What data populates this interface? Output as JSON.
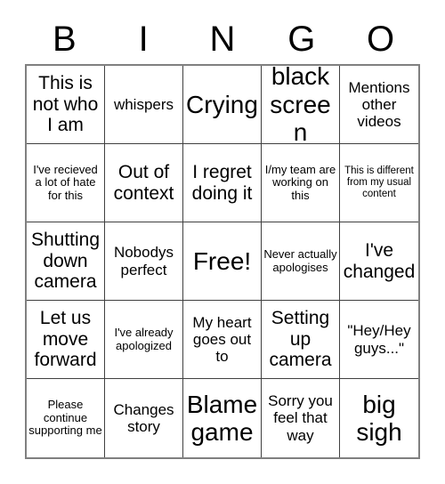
{
  "card": {
    "title_letters": [
      "B",
      "I",
      "N",
      "G",
      "O"
    ],
    "rows": 5,
    "columns": 5,
    "colors": {
      "background": "#ffffff",
      "text": "#000000",
      "grid_line": "#404040",
      "grid_border": "#808080"
    },
    "cells": [
      {
        "text": "This is not who I am",
        "size": "lg"
      },
      {
        "text": "whispers",
        "size": "md"
      },
      {
        "text": "Crying",
        "size": "xl"
      },
      {
        "text": "black screen",
        "size": "xl"
      },
      {
        "text": "Mentions other videos",
        "size": "md"
      },
      {
        "text": "I've recieved a lot of hate for this",
        "size": "sm"
      },
      {
        "text": "Out of context",
        "size": "lg"
      },
      {
        "text": "I regret doing it",
        "size": "lg"
      },
      {
        "text": "I/my team are working on this",
        "size": "sm"
      },
      {
        "text": "This is different from my usual content",
        "size": "xs"
      },
      {
        "text": "Shutting down camera",
        "size": "lg"
      },
      {
        "text": "Nobodys perfect",
        "size": "md"
      },
      {
        "text": "Free!",
        "size": "xl"
      },
      {
        "text": "Never actually apologises",
        "size": "sm"
      },
      {
        "text": "I've changed",
        "size": "lg"
      },
      {
        "text": "Let us move forward",
        "size": "lg"
      },
      {
        "text": "I've already apologized",
        "size": "sm"
      },
      {
        "text": "My heart goes out to",
        "size": "md"
      },
      {
        "text": "Setting up camera",
        "size": "lg"
      },
      {
        "text": "\"Hey/Hey guys...\"",
        "size": "md"
      },
      {
        "text": "Please continue supporting me",
        "size": "sm"
      },
      {
        "text": "Changes story",
        "size": "md"
      },
      {
        "text": "Blame game",
        "size": "xl"
      },
      {
        "text": "Sorry you feel that way",
        "size": "md"
      },
      {
        "text": "big sigh",
        "size": "xl"
      }
    ]
  }
}
